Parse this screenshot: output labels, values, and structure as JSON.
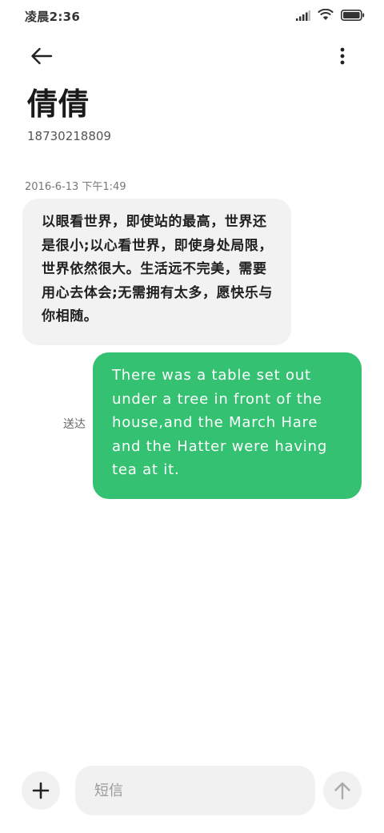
{
  "status_bar": {
    "time": "凌晨2:36",
    "icons": [
      "signal-icon",
      "wifi-icon",
      "battery-icon"
    ]
  },
  "header": {
    "back_icon": "arrow-left-icon",
    "more_icon": "more-vertical-icon",
    "contact_name": "倩倩",
    "contact_number": "18730218809"
  },
  "conversation": {
    "timestamp": "2016-6-13 下午1:49",
    "incoming_message": "以眼看世界，即使站的最高，世界还是很小;以心看世界，即使身处局限，世界依然很大。生活远不完美，需要用心去体会;无需拥有太多，愿快乐与你相随。",
    "outgoing_message": "There was a table set out under a tree in front of the house,and the March Hare and the Hatter were having tea at it.",
    "outgoing_status": "送达"
  },
  "composer": {
    "add_icon": "plus-icon",
    "placeholder": "短信",
    "send_icon": "arrow-up-icon"
  },
  "colors": {
    "outgoing_bubble": "#34c172",
    "incoming_bubble": "#f2f2f2",
    "background": "#ffffff"
  }
}
